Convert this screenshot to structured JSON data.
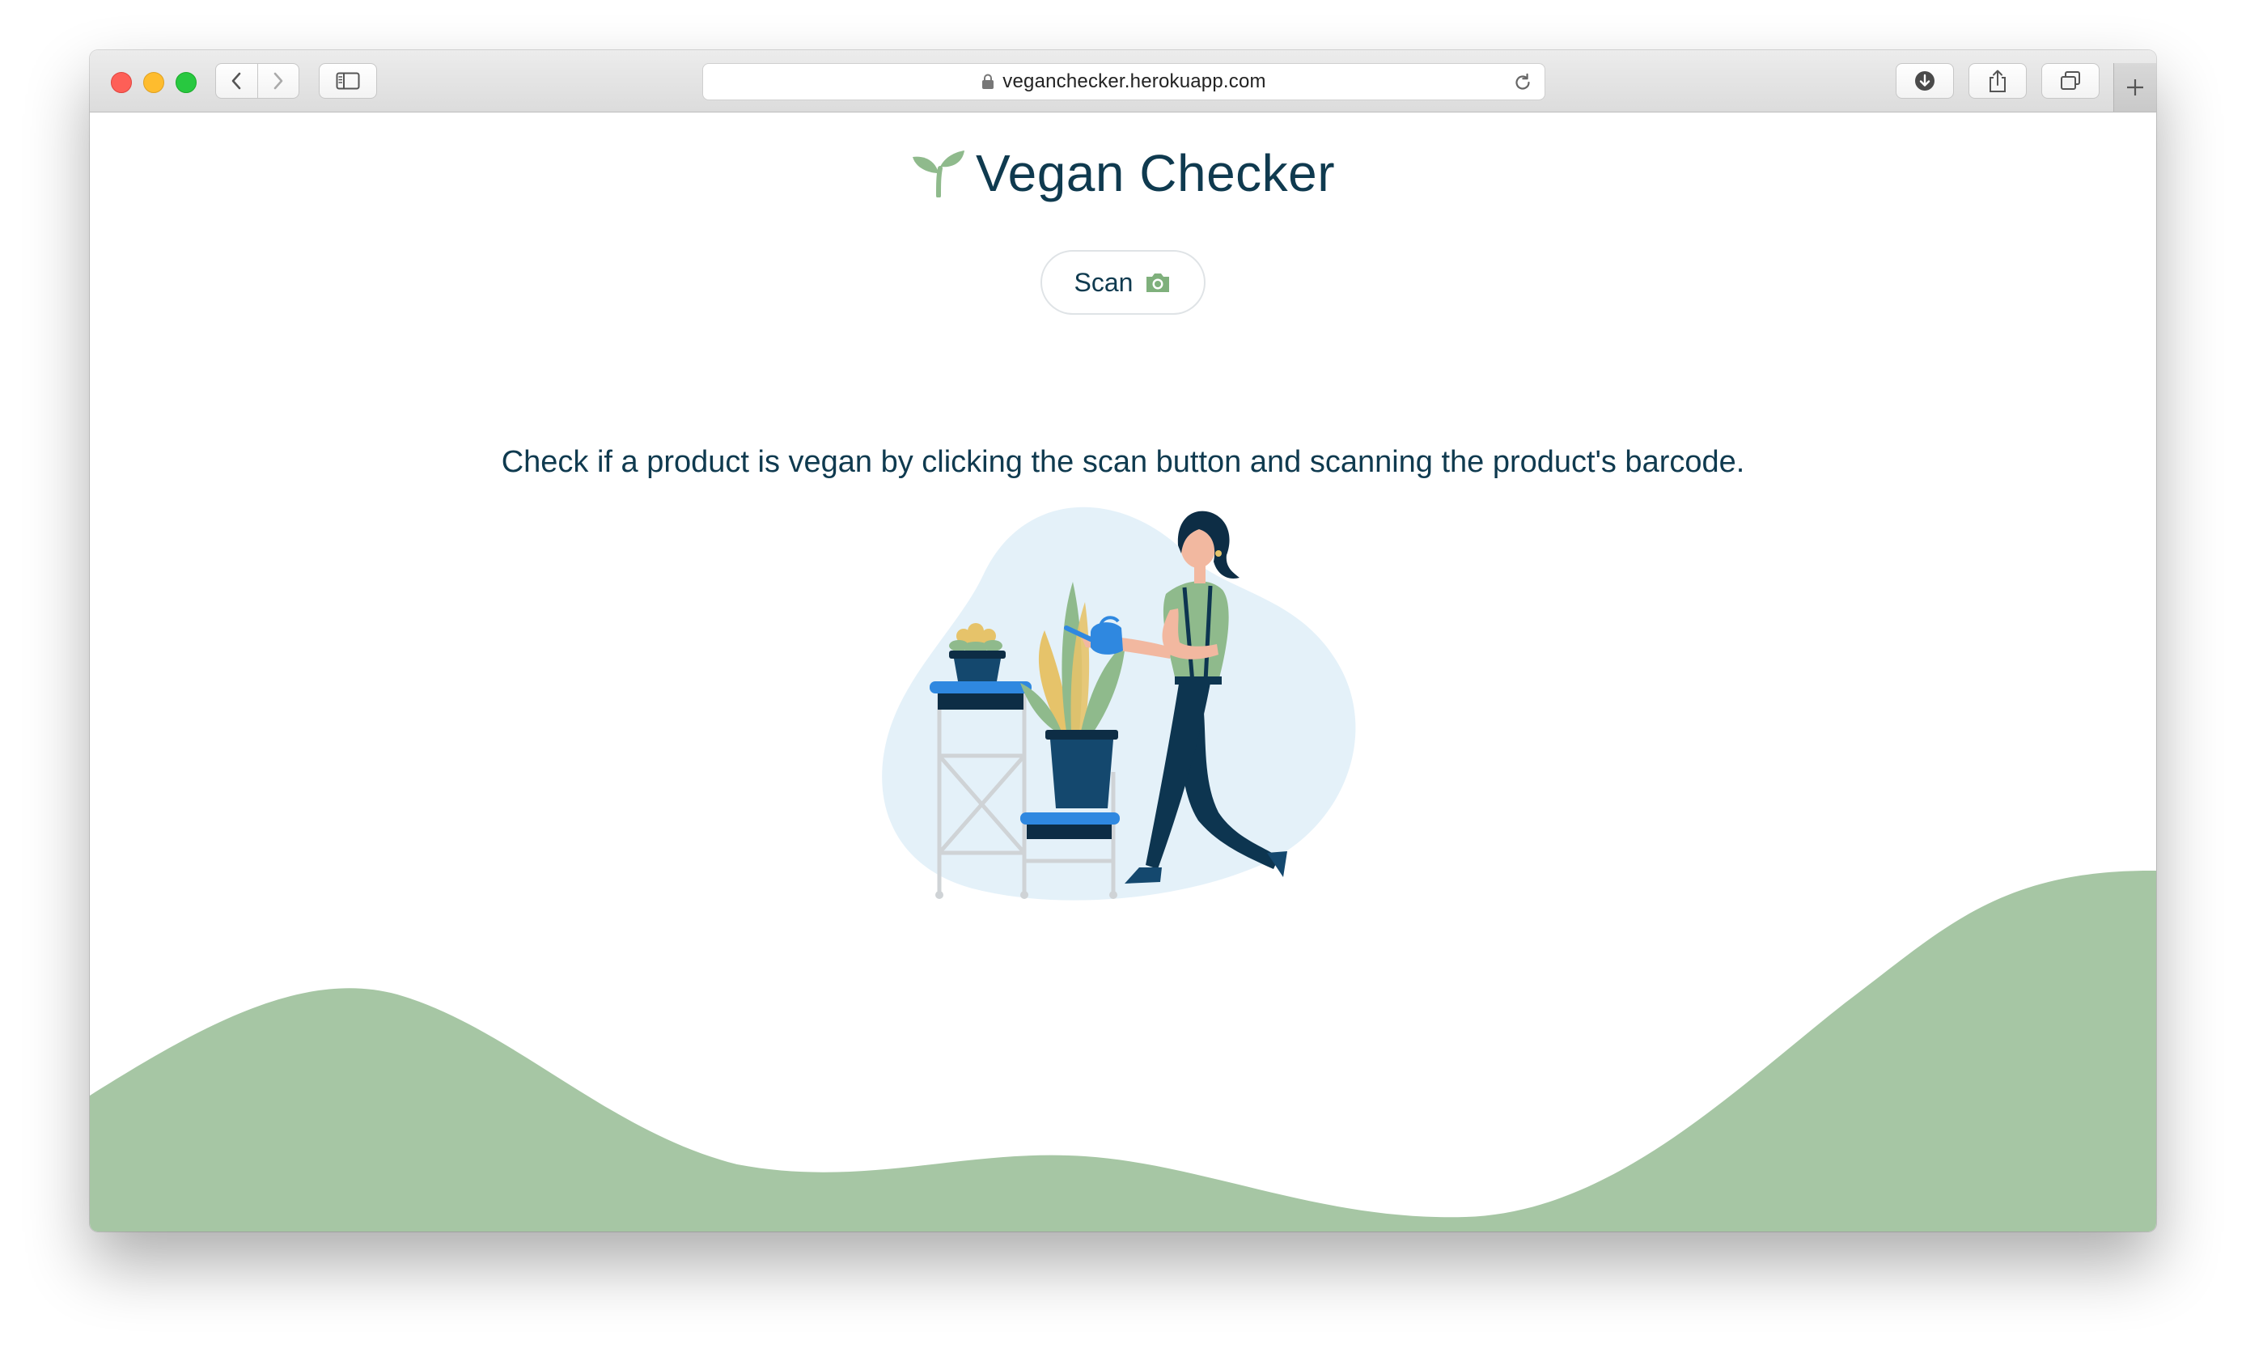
{
  "browser": {
    "url": "veganchecker.herokuapp.com",
    "icons": {
      "back": "chevron-left-icon",
      "forward": "chevron-right-icon",
      "sidebar": "sidebar-icon",
      "lock": "lock-icon",
      "reload": "reload-icon",
      "downloads": "download-icon",
      "share": "share-icon",
      "tabs": "tabs-overview-icon",
      "new_tab": "plus-icon"
    }
  },
  "app": {
    "title": "Vegan Checker",
    "logo_icon": "sprout-icon",
    "scan_button": {
      "label": "Scan",
      "icon": "camera-icon"
    },
    "lead_text": "Check if a product is vegan by clicking the scan button and scanning the product's barcode."
  },
  "colors": {
    "brand_text": "#0f3a4f",
    "accent_green": "#a6c6a4",
    "illustration_blob": "#e4f1f9",
    "accent_blue": "#2f88e0"
  }
}
